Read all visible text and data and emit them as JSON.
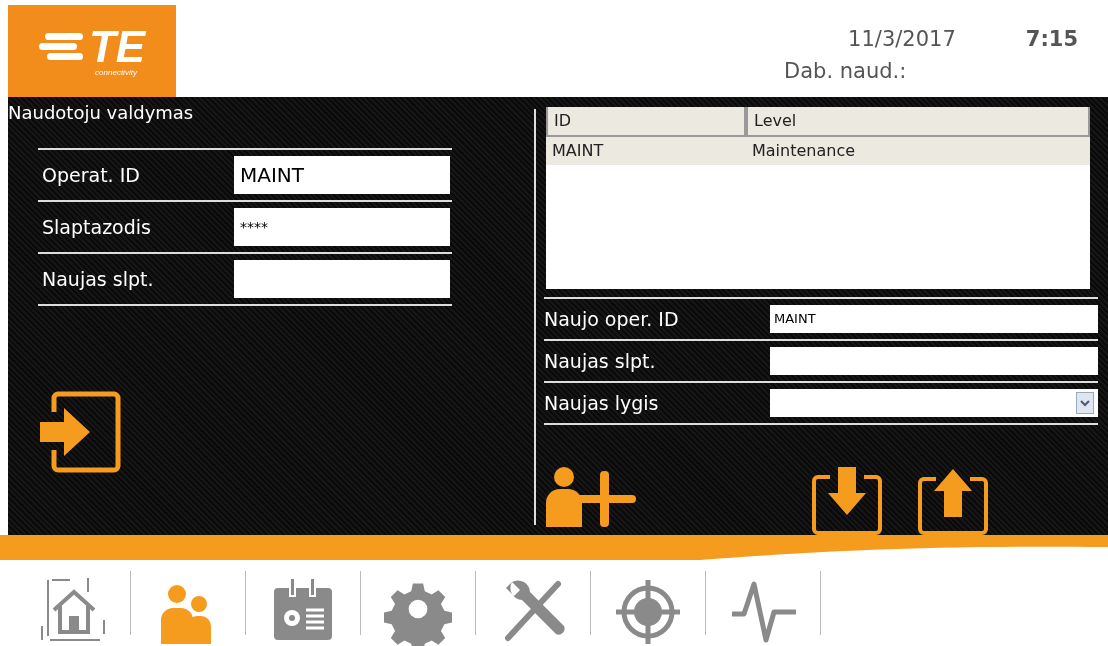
{
  "header": {
    "logo": {
      "mark": "TE",
      "tagline": "connectivity"
    },
    "date": "11/3/2017",
    "time": "7:15",
    "current_user_label": "Dab. naud.:"
  },
  "login_panel": {
    "title": "Naudotoju valdymas",
    "fields": [
      {
        "label": "Operat. ID",
        "value": "MAINT"
      },
      {
        "label": "Slaptazodis",
        "value": "****"
      },
      {
        "label": "Naujas slpt."
      }
    ]
  },
  "user_table": {
    "columns": [
      "ID",
      "Level"
    ],
    "rows": [
      {
        "cells": [
          "MAINT",
          "Maintenance"
        ],
        "selected": true
      }
    ]
  },
  "new_user": {
    "fields": [
      {
        "label": "Naujo oper. ID",
        "value": "MAINT",
        "kind": "text"
      },
      {
        "label": "Naujas slpt.",
        "kind": "text"
      },
      {
        "label": "Naujas lygis",
        "kind": "select"
      }
    ]
  },
  "nav": [
    {
      "selected": false
    },
    {
      "selected": true
    },
    {
      "selected": false
    },
    {
      "selected": false
    },
    {
      "selected": false
    },
    {
      "selected": false
    },
    {
      "selected": false
    }
  ]
}
